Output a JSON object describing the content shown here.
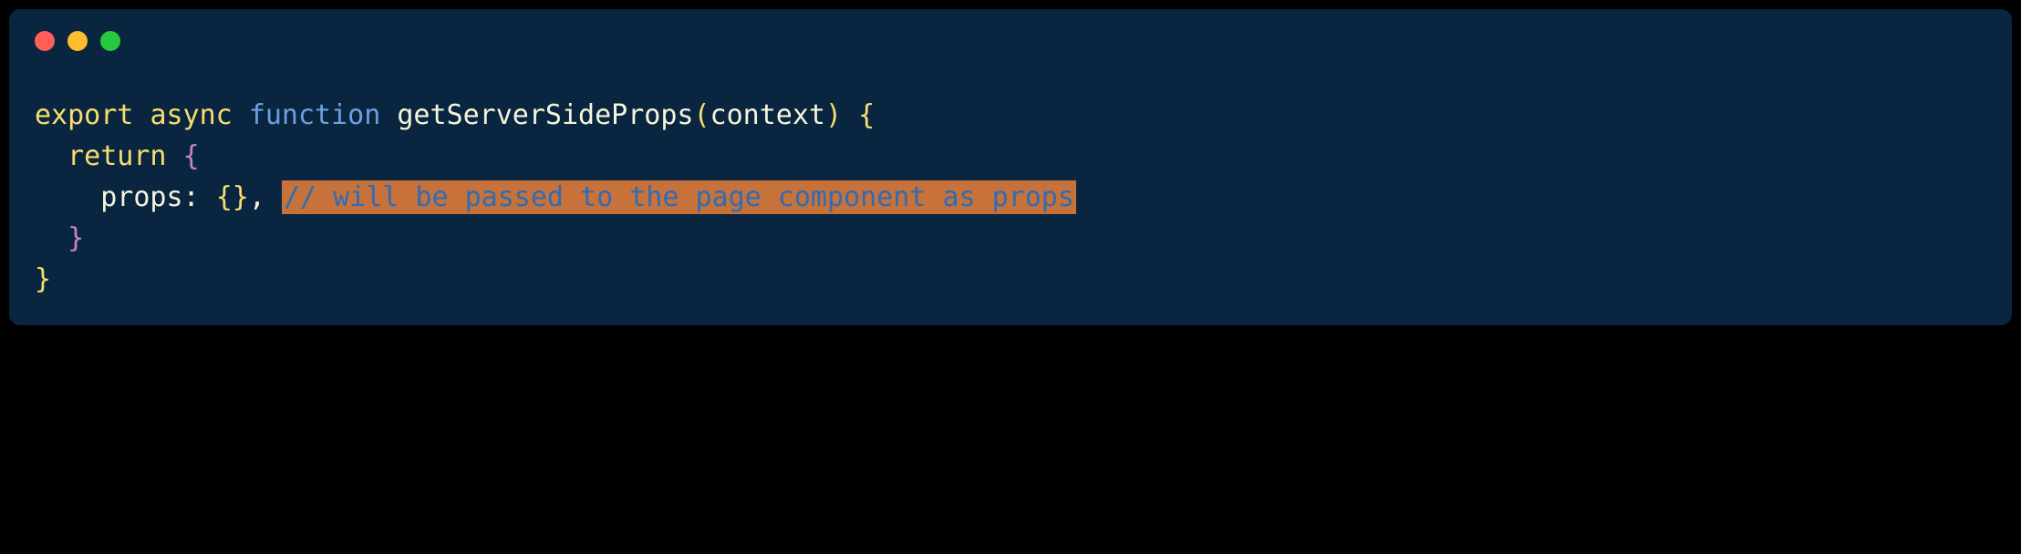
{
  "code": {
    "tokens": {
      "export": "export",
      "async": "async",
      "function": "function",
      "fn_name": "getServerSideProps",
      "param": "context",
      "return": "return",
      "prop": "props",
      "empty_obj_open": "{",
      "empty_obj_close": "}",
      "comment": "// will be passed to the page component as props"
    }
  }
}
